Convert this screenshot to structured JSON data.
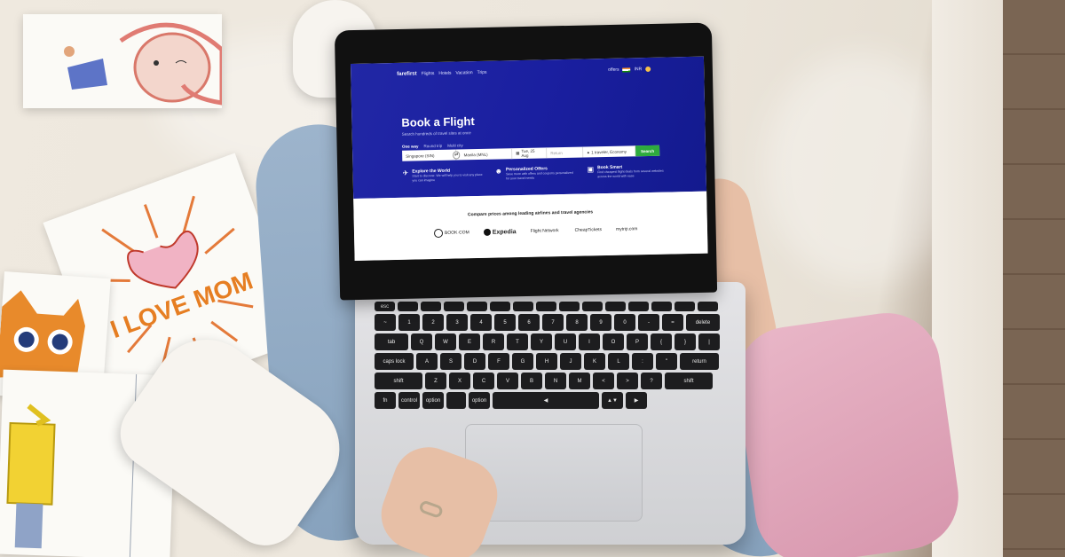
{
  "site": {
    "brand": "farefirst",
    "nav_links": [
      "Flights",
      "Hotels",
      "Vacation",
      "Trips"
    ],
    "nav_right_label": "offers",
    "currency_label": "INR",
    "hero_title": "Book a Flight",
    "hero_subtitle": "Search hundreds of travel sites at once",
    "trip_tabs": [
      "One way",
      "Round trip",
      "Multi city"
    ],
    "search": {
      "from": "Singapore (SIN)",
      "to": "Manila (MNL)",
      "date": "Tue, 25 Aug",
      "return_placeholder": "Return",
      "passengers": "1 traveler, Economy",
      "button": "Search"
    },
    "features": [
      {
        "icon": "plane-icon",
        "title": "Explore the World",
        "text": "Start to discover. We will help you to visit any place you can imagine"
      },
      {
        "icon": "user-icon",
        "title": "Personalized Offers",
        "text": "Save more with offers and coupons personalized for your travel needs"
      },
      {
        "icon": "ticket-icon",
        "title": "Book Smart",
        "text": "Find cheapest flight deals from several websites across the world with ease"
      }
    ],
    "compare_title": "Compare prices among leading airlines and travel agencies",
    "partner_logos": [
      "BOOK·COM",
      "Expedia",
      "Flight Network",
      "CheapTickets",
      "mytrip.com"
    ]
  },
  "keyboard": {
    "keys": [
      "esc",
      "",
      "",
      "",
      "",
      "",
      "",
      "",
      "",
      "",
      "",
      "",
      "",
      "",
      "",
      "~",
      "1",
      "2",
      "3",
      "4",
      "5",
      "6",
      "7",
      "8",
      "9",
      "0",
      "-",
      "=",
      "delete",
      "tab",
      "Q",
      "W",
      "E",
      "R",
      "T",
      "Y",
      "U",
      "I",
      "O",
      "P",
      "{",
      "}",
      "|",
      "caps lock",
      "A",
      "S",
      "D",
      "F",
      "G",
      "H",
      "J",
      "K",
      "L",
      ":",
      "\"",
      "return",
      "shift",
      "Z",
      "X",
      "C",
      "V",
      "B",
      "N",
      "M",
      "<",
      ">",
      "?",
      "shift",
      "fn",
      "control",
      "option",
      "",
      "option",
      "◀",
      "▲▼",
      "▶"
    ]
  },
  "drawings": {
    "card_text": "I LOVE MOM"
  },
  "colors": {
    "hero_blue": "#1a1fa0",
    "search_green": "#2eaa3e",
    "sleeve_pink": "#e2a9bd"
  }
}
